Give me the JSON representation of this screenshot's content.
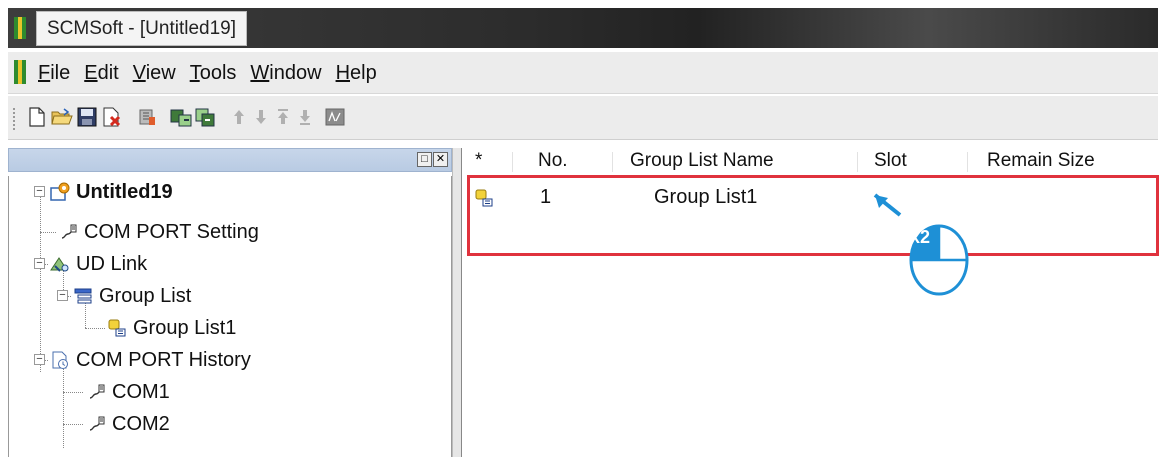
{
  "window": {
    "title": "SCMSoft - [Untitled19]"
  },
  "menu": {
    "items": [
      {
        "id": "file",
        "accel": "F",
        "rest": "ile"
      },
      {
        "id": "edit",
        "accel": "E",
        "rest": "dit"
      },
      {
        "id": "view",
        "accel": "V",
        "rest": "iew"
      },
      {
        "id": "tools",
        "accel": "T",
        "rest": "ools"
      },
      {
        "id": "window",
        "accel": "W",
        "rest": "indow"
      },
      {
        "id": "help",
        "accel": "H",
        "rest": "elp"
      }
    ]
  },
  "toolbar": {
    "buttons": [
      "new-file-icon",
      "open-folder-icon",
      "save-icon",
      "close-project-icon",
      "settings-icon",
      "upload-icon",
      "download-icon",
      "move-up-icon",
      "move-down-icon",
      "move-top-icon",
      "move-bottom-icon",
      "monitor-icon"
    ]
  },
  "tree": {
    "root": "Untitled19",
    "com_port_setting": "COM PORT Setting",
    "ud_link": "UD Link",
    "group_list": "Group List",
    "group_list1": "Group List1",
    "com_port_history": "COM PORT History",
    "com1": "COM1",
    "com2": "COM2"
  },
  "list": {
    "columns": {
      "star": "*",
      "no": "No.",
      "name": "Group List Name",
      "slot": "Slot",
      "remain": "Remain Size"
    },
    "rows": [
      {
        "no": "1",
        "name": "Group List1",
        "slot": "",
        "remain": ""
      }
    ]
  },
  "annotation": {
    "clicks": "x2",
    "color": "#1e90d6",
    "highlight_color": "#e0323d"
  }
}
